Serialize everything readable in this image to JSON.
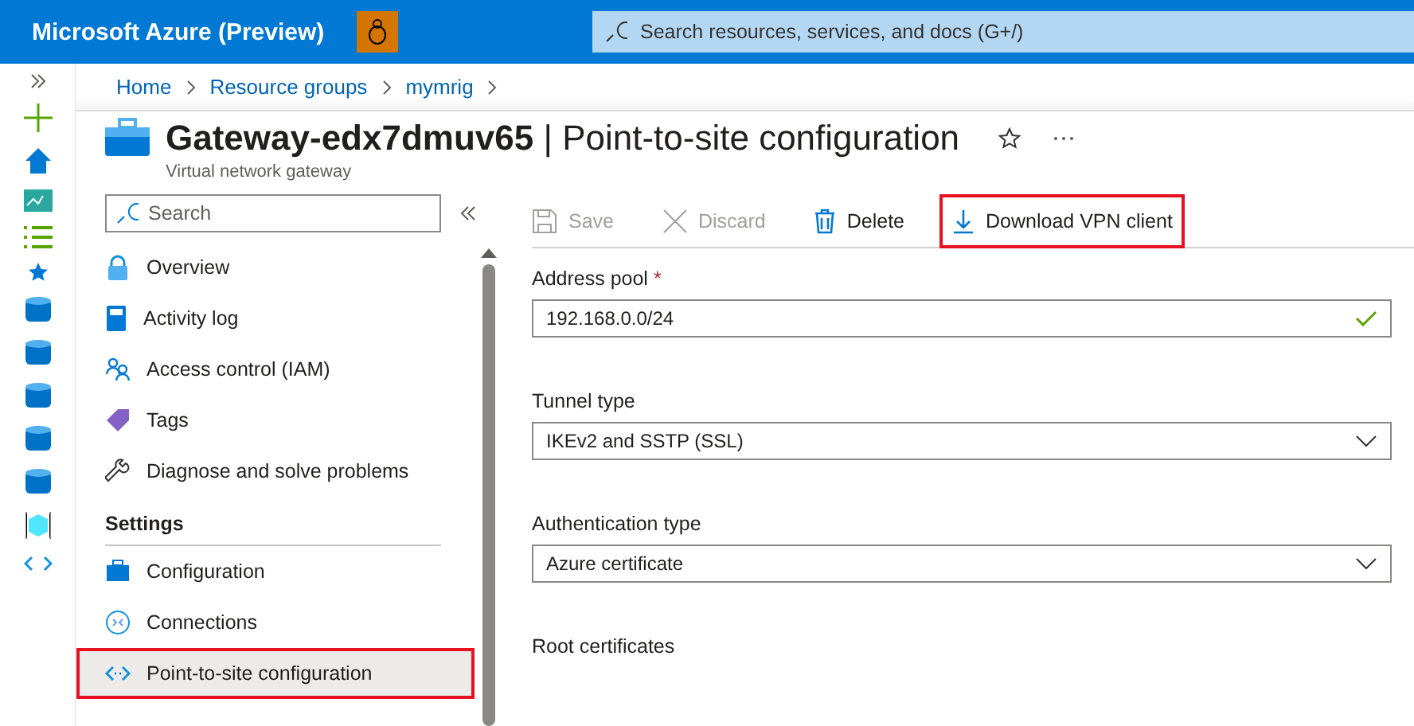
{
  "header": {
    "title": "Microsoft Azure (Preview)",
    "search": {
      "placeholder": "Search resources, services, and docs (G+/)"
    }
  },
  "breadcrumb": [
    "Home",
    "Resource groups",
    "mymrig"
  ],
  "resource": {
    "name": "Gateway-edx7dmuv65",
    "separator": "|",
    "page": "Point-to-site configuration",
    "subtitle": "Virtual network gateway"
  },
  "nav": {
    "search": {
      "placeholder": "Search"
    },
    "sections": [
      {
        "items": [
          {
            "label": "Overview",
            "selected": false,
            "highlighted": false
          },
          {
            "label": "Activity log",
            "selected": false,
            "highlighted": false
          },
          {
            "label": "Access control (IAM)",
            "selected": false,
            "highlighted": false
          },
          {
            "label": "Tags",
            "selected": false,
            "highlighted": false
          },
          {
            "label": "Diagnose and solve problems",
            "selected": false,
            "highlighted": false
          }
        ]
      },
      {
        "heading": "Settings",
        "items": [
          {
            "label": "Configuration",
            "selected": false,
            "highlighted": false
          },
          {
            "label": "Connections",
            "selected": false,
            "highlighted": false
          },
          {
            "label": "Point-to-site configuration",
            "selected": true,
            "highlighted": true
          }
        ]
      }
    ]
  },
  "toolbar": [
    {
      "label": "Save",
      "disabled": true,
      "highlighted": false
    },
    {
      "label": "Discard",
      "disabled": true,
      "highlighted": false
    },
    {
      "label": "Delete",
      "disabled": false,
      "highlighted": false
    },
    {
      "label": "Download VPN client",
      "disabled": false,
      "highlighted": true
    }
  ],
  "form": [
    {
      "kind": "text",
      "label": "Address pool",
      "required_mark": "*",
      "value": "192.168.0.0/24",
      "valid": true
    },
    {
      "kind": "select",
      "label": "Tunnel type",
      "value": "IKEv2 and SSTP (SSL)"
    },
    {
      "kind": "select",
      "label": "Authentication type",
      "value": "Azure certificate"
    },
    {
      "kind": "heading",
      "label": "Root certificates"
    }
  ]
}
